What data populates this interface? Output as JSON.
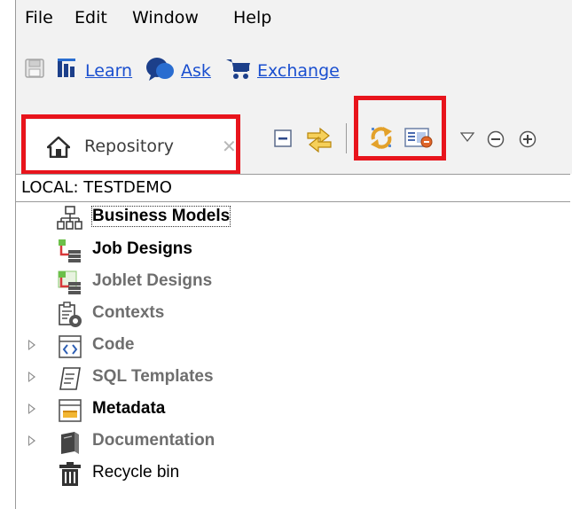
{
  "menu": {
    "file": "File",
    "edit": "Edit",
    "window": "Window",
    "help": "Help"
  },
  "toolbar": {
    "learn": "Learn",
    "ask": "Ask",
    "exchange": "Exchange",
    "icons": [
      "save-icon",
      "learn-icon",
      "ask-icon",
      "exchange-cart-icon"
    ]
  },
  "view": {
    "tab_label": "Repository",
    "tab_close": "✕",
    "icons": [
      "collapse-all-icon",
      "link-with-editor-icon",
      "refresh-icon",
      "filter-icon",
      "view-menu-icon",
      "minimize-icon",
      "maximize-icon"
    ],
    "highlight_color": "#e8141c"
  },
  "tree": {
    "root": "LOCAL: TESTDEMO",
    "items": [
      {
        "label": "Business Models",
        "icon": "business-models-icon",
        "expandable": false,
        "style": "bold-black",
        "focused": true
      },
      {
        "label": "Job Designs",
        "icon": "job-designs-icon",
        "expandable": false,
        "style": "bold-black",
        "focused": false
      },
      {
        "label": "Joblet Designs",
        "icon": "joblet-designs-icon",
        "expandable": false,
        "style": "bold-gray",
        "focused": false
      },
      {
        "label": "Contexts",
        "icon": "contexts-icon",
        "expandable": false,
        "style": "bold-gray",
        "focused": false
      },
      {
        "label": "Code",
        "icon": "code-icon",
        "expandable": true,
        "style": "bold-gray",
        "focused": false
      },
      {
        "label": "SQL Templates",
        "icon": "sql-templates-icon",
        "expandable": true,
        "style": "bold-gray",
        "focused": false
      },
      {
        "label": "Metadata",
        "icon": "metadata-icon",
        "expandable": true,
        "style": "bold-black",
        "focused": false
      },
      {
        "label": "Documentation",
        "icon": "documentation-icon",
        "expandable": true,
        "style": "bold-gray",
        "focused": false
      },
      {
        "label": "Recycle bin",
        "icon": "recycle-bin-icon",
        "expandable": false,
        "style": "normal",
        "focused": false
      }
    ]
  }
}
